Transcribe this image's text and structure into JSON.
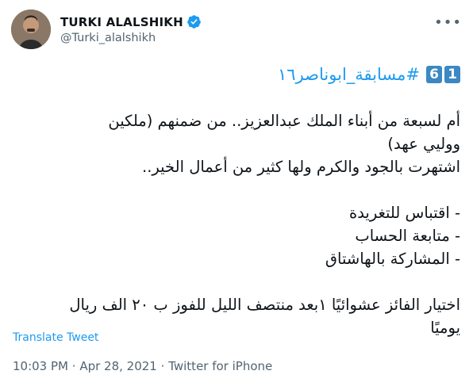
{
  "author": {
    "name": "TURKI ALALSHIKH",
    "handle": "@Turki_alalshikh"
  },
  "menu_icon_glyph": "•••",
  "hashtag": {
    "emoji_digits": [
      "1",
      "6"
    ],
    "text": "#مسابقة_ابوناصر١٦"
  },
  "body_lines": [
    "أم لسبعة من أبناء الملك عبدالعزيز.. من ضمنهم (ملكين",
    "ووليي عهد)",
    "اشتهرت بالجود والكرم ولها كثير من أعمال الخير..",
    "",
    "-  اقتباس للتغريدة",
    "- متابعة الحساب",
    "- المشاركة بالهاشتاق",
    "",
    "اختيار الفائز عشوائيًا ١بعد منتصف الليل للفوز ب ٢٠ الف ريال",
    "يوميًا"
  ],
  "translate_label": "Translate Tweet",
  "meta": {
    "time": "10:03 PM",
    "separator": "·",
    "date": "Apr 28, 2021",
    "source": "Twitter for iPhone"
  },
  "colors": {
    "link": "#1d9bf0",
    "secondary_text": "#536471",
    "emoji_key": "#3b88c3",
    "verified": "#1d9bf0"
  }
}
